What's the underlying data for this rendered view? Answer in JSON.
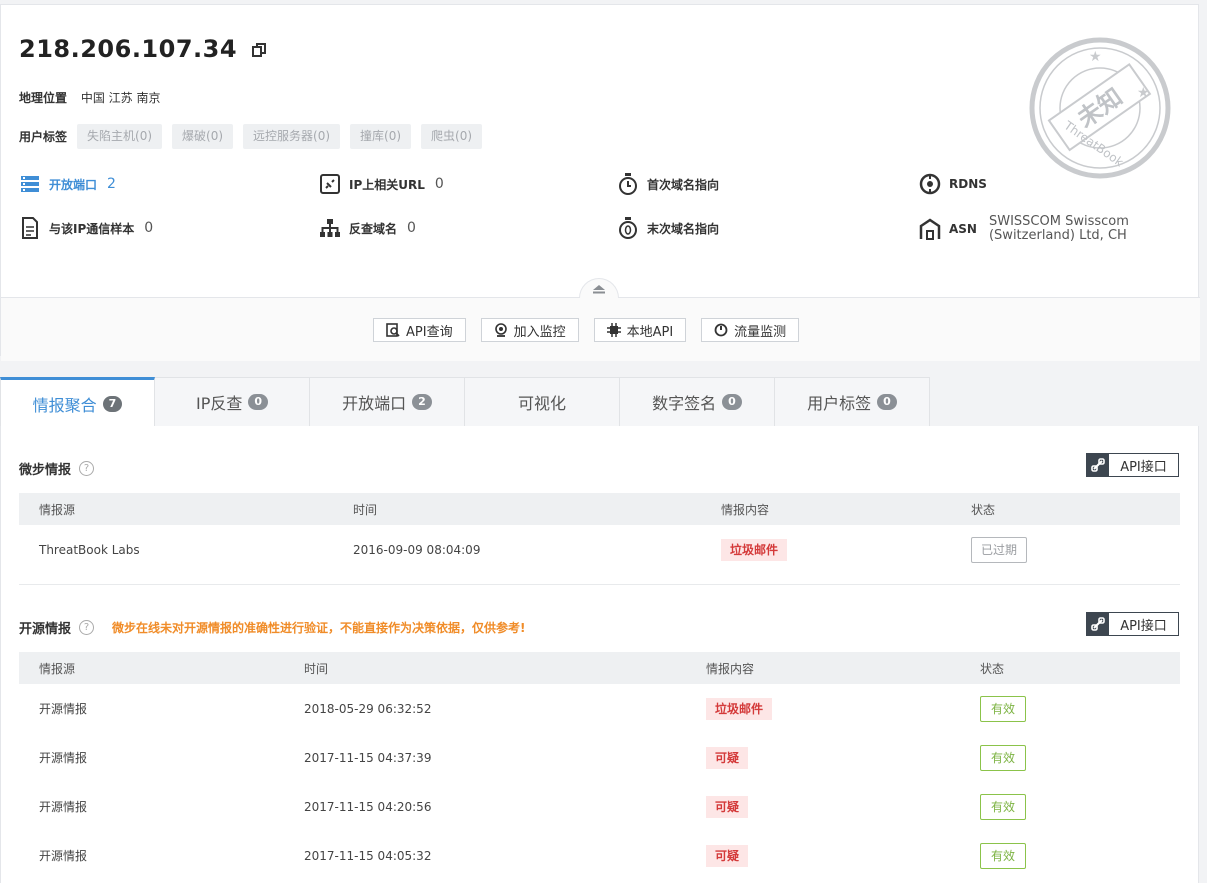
{
  "header": {
    "ip": "218.206.107.34",
    "geo_label": "地理位置",
    "geo_value": "中国 江苏 南京",
    "tags_label": "用户标签",
    "tags": [
      "失陷主机(0)",
      "爆破(0)",
      "远控服务器(0)",
      "撞库(0)",
      "爬虫(0)"
    ],
    "stamp_text": "未知",
    "stamp_brand": "ThreatBook"
  },
  "info": {
    "open_ports_label": "开放端口",
    "open_ports_value": "2",
    "related_url_label": "IP上相关URL",
    "related_url_value": "0",
    "first_domain_label": "首次域名指向",
    "rdns_label": "RDNS",
    "samples_label": "与该IP通信样本",
    "samples_value": "0",
    "reverse_domain_label": "反查域名",
    "reverse_domain_value": "0",
    "last_domain_label": "末次域名指向",
    "asn_label": "ASN",
    "asn_value": "SWISSCOM Swisscom (Switzerland) Ltd, CH"
  },
  "actions": [
    "API查询",
    "加入监控",
    "本地API",
    "流量监测"
  ],
  "tabs": [
    {
      "label": "情报聚合",
      "count": "7"
    },
    {
      "label": "IP反查",
      "count": "0"
    },
    {
      "label": "开放端口",
      "count": "2"
    },
    {
      "label": "可视化",
      "count": ""
    },
    {
      "label": "数字签名",
      "count": "0"
    },
    {
      "label": "用户标签",
      "count": "0"
    }
  ],
  "weibu": {
    "title": "微步情报",
    "api_label": "API接口",
    "columns": [
      "情报源",
      "时间",
      "情报内容",
      "状态"
    ],
    "rows": [
      {
        "source": "ThreatBook Labs",
        "time": "2016-09-09 08:04:09",
        "content": "垃圾邮件",
        "status": "已过期"
      }
    ]
  },
  "opensource": {
    "title": "开源情报",
    "warning": "微步在线未对开源情报的准确性进行验证，不能直接作为决策依据，仅供参考!",
    "api_label": "API接口",
    "columns": [
      "情报源",
      "时间",
      "情报内容",
      "状态"
    ],
    "rows": [
      {
        "source": "开源情报",
        "time": "2018-05-29 06:32:52",
        "content": "垃圾邮件",
        "status": "有效"
      },
      {
        "source": "开源情报",
        "time": "2017-11-15 04:37:39",
        "content": "可疑",
        "status": "有效"
      },
      {
        "source": "开源情报",
        "time": "2017-11-15 04:20:56",
        "content": "可疑",
        "status": "有效"
      },
      {
        "source": "开源情报",
        "time": "2017-11-15 04:05:32",
        "content": "可疑",
        "status": "有效"
      }
    ]
  },
  "colors": {
    "accent": "#3f8ed6",
    "danger": "#d43a3a",
    "ok": "#7cb342",
    "warn": "#f08c28"
  }
}
